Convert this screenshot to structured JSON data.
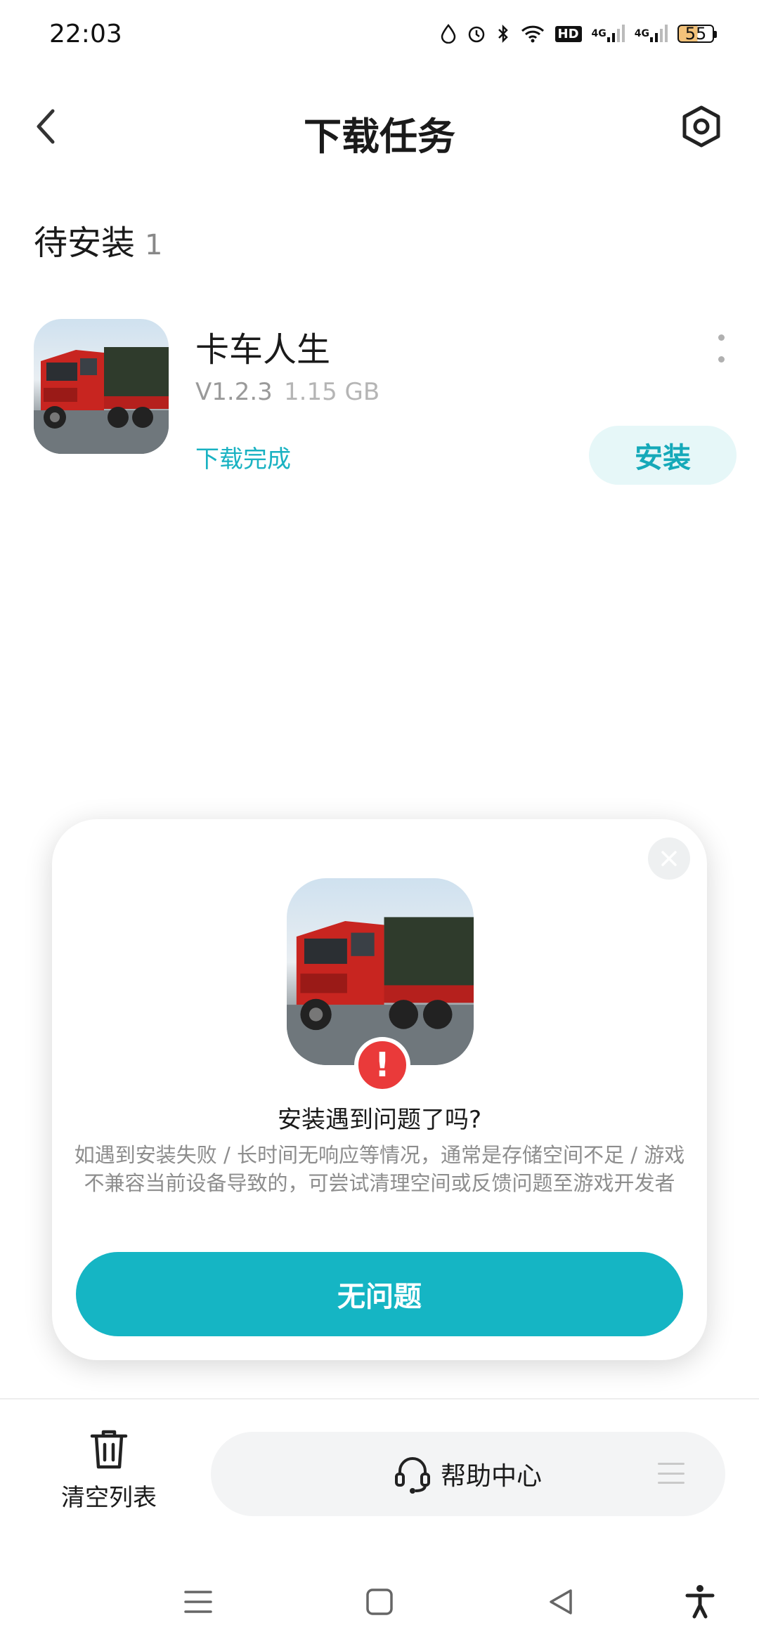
{
  "status_bar": {
    "time": "22:03",
    "hd_label": "HD",
    "net1": "4G",
    "net2": "4G",
    "battery": "55"
  },
  "header": {
    "title": "下载任务"
  },
  "section": {
    "title": "待安装",
    "count": "1"
  },
  "task": {
    "name": "卡车人生",
    "version": "V1.2.3",
    "size": "1.15 GB",
    "status": "下载完成",
    "install_label": "安装"
  },
  "dialog": {
    "title": "安装遇到问题了吗?",
    "description": "如遇到安装失败 / 长时间无响应等情况，通常是存储空间不足 / 游戏不兼容当前设备导致的，可尝试清理空间或反馈问题至游戏开发者",
    "confirm_label": "无问题"
  },
  "toolbar": {
    "clear_label": "清空列表",
    "help_label": "帮助中心"
  },
  "colors": {
    "accent": "#15b5c4",
    "warning": "#ea3a3a"
  }
}
